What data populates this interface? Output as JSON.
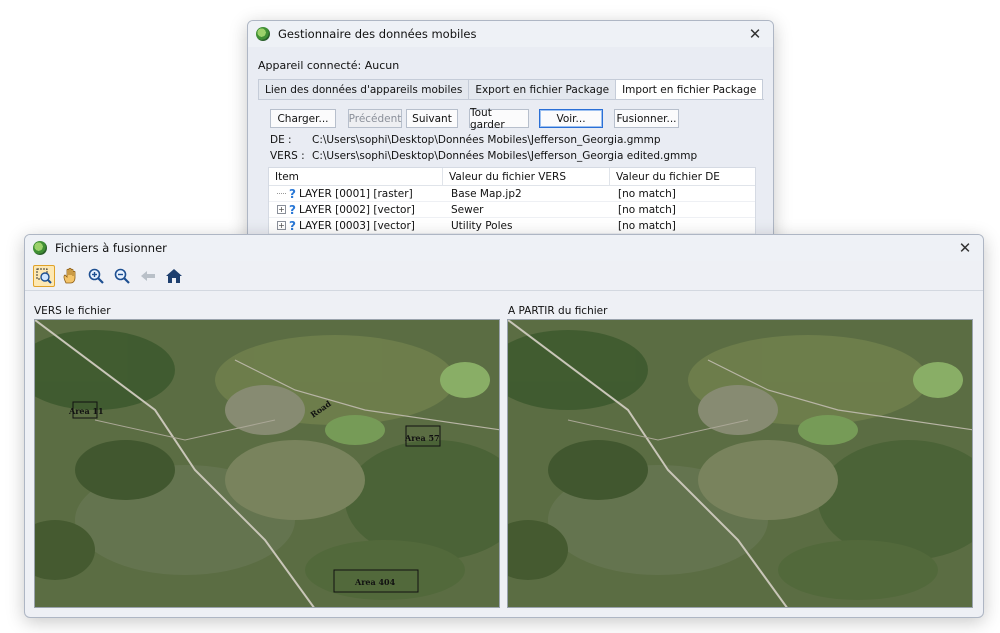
{
  "dialog_manager": {
    "title": "Gestionnaire des données mobiles",
    "connected": "Appareil connecté: Aucun",
    "tabs": [
      "Lien des données d'appareils mobiles",
      "Export en fichier Package",
      "Import en fichier Package"
    ],
    "buttons": {
      "load": "Charger...",
      "previous": "Précédent",
      "next": "Suivant",
      "keep_all": "Tout garder",
      "view": "Voir...",
      "merge": "Fusionner..."
    },
    "from_label": "DE :",
    "from_path": "C:\\Users\\sophi\\Desktop\\Données Mobiles\\Jefferson_Georgia.gmmp",
    "to_label": "VERS :",
    "to_path": "C:\\Users\\sophi\\Desktop\\Données Mobiles\\Jefferson_Georgia edited.gmmp",
    "grid": {
      "headers": [
        "Item",
        "Valeur du fichier VERS",
        "Valeur du fichier DE"
      ],
      "rows": [
        {
          "item": "LAYER [0001] [raster]",
          "to": "Base Map.jp2",
          "from": "[no match]"
        },
        {
          "item": "LAYER [0002] [vector]",
          "to": "Sewer",
          "from": "[no match]"
        },
        {
          "item": "LAYER [0003] [vector]",
          "to": "Utility Poles",
          "from": "[no match]"
        }
      ]
    }
  },
  "dialog_files": {
    "title": "Fichiers à fusionner",
    "left_label": "VERS le fichier",
    "right_label": "A PARTIR du fichier",
    "map_labels": [
      "Area 11",
      "Area 57",
      "Area 404",
      "Road"
    ]
  },
  "colors": {
    "accent_focus": "#2a6fd6",
    "active_tool": "#fde8b3",
    "question_icon": "#2a78d6"
  }
}
